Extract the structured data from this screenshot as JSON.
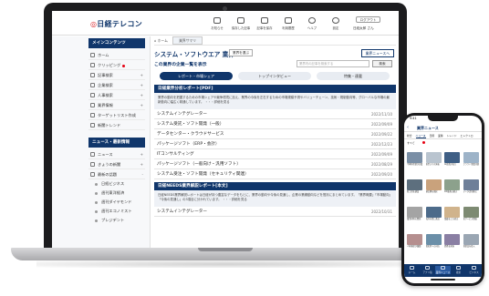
{
  "brand": {
    "logo": "日経テレコン"
  },
  "header_nav": [
    {
      "label": "お知らせ",
      "icon": "bell-icon"
    },
    {
      "label": "保存した記事",
      "icon": "bookmark-icon"
    },
    {
      "label": "記事を保存",
      "icon": "save-icon"
    },
    {
      "label": "利用履歴",
      "icon": "history-icon"
    },
    {
      "label": "ヘルプ",
      "icon": "help-icon"
    },
    {
      "label": "設定",
      "icon": "gear-icon"
    }
  ],
  "header": {
    "logout": "ログアウト",
    "user": "日経太郎 さん"
  },
  "sidebar": {
    "section1": "メインコンテンツ",
    "items1": [
      {
        "label": "ホーム",
        "plus": ""
      },
      {
        "label": "クリッピング",
        "plus": ""
      },
      {
        "label": "記事検索",
        "plus": "+"
      },
      {
        "label": "企業検索",
        "plus": "+"
      },
      {
        "label": "人事検索",
        "plus": "+"
      },
      {
        "label": "業界情報",
        "plus": "+"
      },
      {
        "label": "ターゲットリスト作成",
        "plus": ""
      },
      {
        "label": "新聞トレンド",
        "plus": ""
      }
    ],
    "section2": "ニュース・最新情報",
    "items2": [
      {
        "label": "ニュース",
        "plus": "+"
      },
      {
        "label": "きょうの新聞",
        "plus": "+"
      },
      {
        "label": "最新の話題",
        "plus": "-"
      }
    ],
    "sub_items": [
      "日経ビジネス",
      "週刊東洋経済",
      "週刊ダイヤモンド",
      "週刊エコノミスト",
      "プレジデント"
    ]
  },
  "main": {
    "breadcrumb_home": "ホーム",
    "breadcrumb_tab": "業界サマリ",
    "title": "システム・ソフトウエア 業界",
    "industry_button": "業界を選ぶ",
    "news_button": "業界ニュースへ",
    "list_link": "この業界の企業一覧を表示",
    "search_placeholder": "業界内の記事を検索する",
    "search_button": "検索",
    "tabs": [
      {
        "label": "レポート・市場シェア"
      },
      {
        "label": "トップインタビュー"
      },
      {
        "label": "特集・連載"
      }
    ],
    "section1": {
      "title": "日経業界分析レポート[PDF]",
      "desc": "業界の動向を把握するための市場シェアや競争環境に加え、業界の今後を左右するための市場規模予測やバリューチェーン、技術・規制動向等、グローバルな市場の最新動向に幅広く精通しています。 ・・・詳細を見る",
      "rows": [
        {
          "title": "システムインテグレーター",
          "date": "2022/11/10"
        },
        {
          "title": "システム受託・ソフト開発（一般）",
          "date": "2022/09/09"
        },
        {
          "title": "データセンター・クラウドサービス",
          "date": "2022/09/22"
        },
        {
          "title": "パッケージソフト（ERP・会計）",
          "date": "2022/12/23"
        },
        {
          "title": "ITコンサルティング",
          "date": "2022/09/09"
        },
        {
          "title": "パッケージソフト（一般向け・汎用ソフト）",
          "date": "2022/08/29"
        },
        {
          "title": "システム受注・ソフト開発（セキュリティ関連）",
          "date": "2022/09/20"
        }
      ]
    },
    "section2": {
      "title": "日経NEEDS業界解説レポート[本文]",
      "desc": "日経NEEDS業界解説レポートは日経が持つ豊富なデータをもとに、業界の動向や今後の見通し、企業の業績動向などを簡潔にまとめています。「業界概要」「市場動向」「今後の見通し」の3項目に分かれています。 ・・・詳細を見る",
      "rows": [
        {
          "title": "システムインテグレーター",
          "date": "2022/10/31"
        }
      ]
    }
  },
  "phone": {
    "status_time": "9:41",
    "back": "‹",
    "title": "業界ニュース",
    "tabs": [
      "総合",
      "ニュース",
      "日経",
      "業種",
      "トレンド",
      "エレクトロ"
    ],
    "sub_label": "すべて",
    "tiles": [
      {
        "caption": "半導体需要が回復",
        "color": "#7a8fa6"
      },
      {
        "caption": "新型スマホ発表",
        "color": "#b9c4cf"
      },
      {
        "caption": "AI投資が拡大",
        "color": "#3f5f85"
      },
      {
        "caption": "クラウド事業好調",
        "color": "#9db3c8"
      },
      {
        "caption": "新工場を建設",
        "color": "#5d6f7e"
      },
      {
        "caption": "通信網を強化",
        "color": "#c9a27c"
      },
      {
        "caption": "DX推進の動き",
        "color": "#8ca18c"
      },
      {
        "caption": "データ活用進む",
        "color": "#6e7f99"
      },
      {
        "caption": "電池材料の開発",
        "color": "#a4a4a4"
      },
      {
        "caption": "海外市場に進出",
        "color": "#4d6b8a"
      },
      {
        "caption": "業績を上方修正",
        "color": "#d0b38c"
      },
      {
        "caption": "新サービス開始",
        "color": "#7d8a72"
      },
      {
        "caption": "人材確保が課題",
        "color": "#b58f8f"
      },
      {
        "caption": "脱炭素への対応",
        "color": "#6b8fa8"
      },
      {
        "caption": "提携を発表",
        "color": "#8a7fa3"
      },
      {
        "caption": "新製品を投入",
        "color": "#9aa6b3"
      }
    ],
    "nav": [
      {
        "label": "ホーム"
      },
      {
        "label": "アプリ版"
      },
      {
        "label": "業界ニュース"
      },
      {
        "label": "検索"
      },
      {
        "label": "ビジネス"
      }
    ]
  }
}
